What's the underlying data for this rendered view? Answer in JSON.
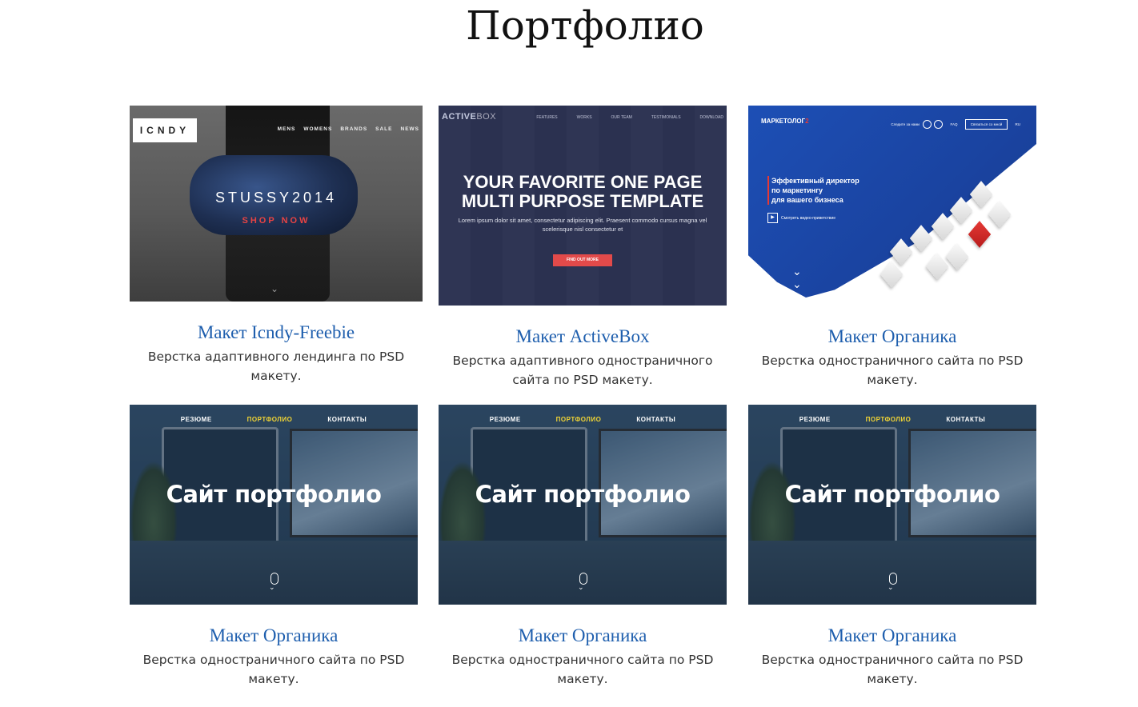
{
  "page": {
    "title": "Портфолио"
  },
  "cards": [
    {
      "title": "Макет Icndy-Freebie",
      "desc": "Верстка адаптивного лендинга по PSD макету."
    },
    {
      "title": "Макет ActiveBox",
      "desc": "Верстка адаптивного одностраничного сайта по PSD макету."
    },
    {
      "title": "Макет Органика",
      "desc": "Верстка одностраничного сайта по PSD макету."
    },
    {
      "title": "Макет Органика",
      "desc": "Верстка одностраничного сайта по PSD макету."
    },
    {
      "title": "Макет Органика",
      "desc": "Верстка одностраничного сайта по PSD макету."
    },
    {
      "title": "Макет Органика",
      "desc": "Верстка одностраничного сайта по PSD макету."
    }
  ],
  "thumbs": {
    "icndy": {
      "logo": "ICNDY",
      "nav": [
        "MENS",
        "WOMENS",
        "BRANDS",
        "SALE",
        "NEWS"
      ],
      "brand": "STUSSY2014",
      "cta": "SHOP NOW"
    },
    "activebox": {
      "logo_a": "ACTIVE",
      "logo_b": "BOX",
      "nav": [
        "FEATURES",
        "WORKS",
        "OUR TEAM",
        "TESTIMONIALS",
        "DOWNLOAD"
      ],
      "headline_1": "YOUR FAVORITE ONE PAGE",
      "headline_2": "MULTI PURPOSE TEMPLATE",
      "sub": "Lorem ipsum dolor sit amet, consectetur adipiscing elit. Praesent commodo cursus magna vel scelerisque nisl consectetur et",
      "cta": "FIND OUT MORE"
    },
    "marketolog": {
      "logo_a": "МАРКЕТОЛОГ",
      "logo_b": "2",
      "nav_follow": "Следите за нами",
      "nav_faq": "FAQ",
      "nav_button": "Связаться со мной",
      "nav_lang": "RU",
      "hero_1": "Эффективный директор",
      "hero_2": "по маркетингу",
      "hero_3": "для вашего бизнеса",
      "video": "Смотреть видео-приветствие"
    },
    "portfolio": {
      "nav": [
        "РЕЗЮМЕ",
        "ПОРТФОЛИО",
        "КОНТАКТЫ"
      ],
      "hero": "Сайт портфолио"
    }
  },
  "colors": {
    "link": "#1f5fae",
    "accent_red": "#e84343",
    "portfolio_nav_active": "#f1d434",
    "marketolog_blue": "#1d4fb5"
  }
}
